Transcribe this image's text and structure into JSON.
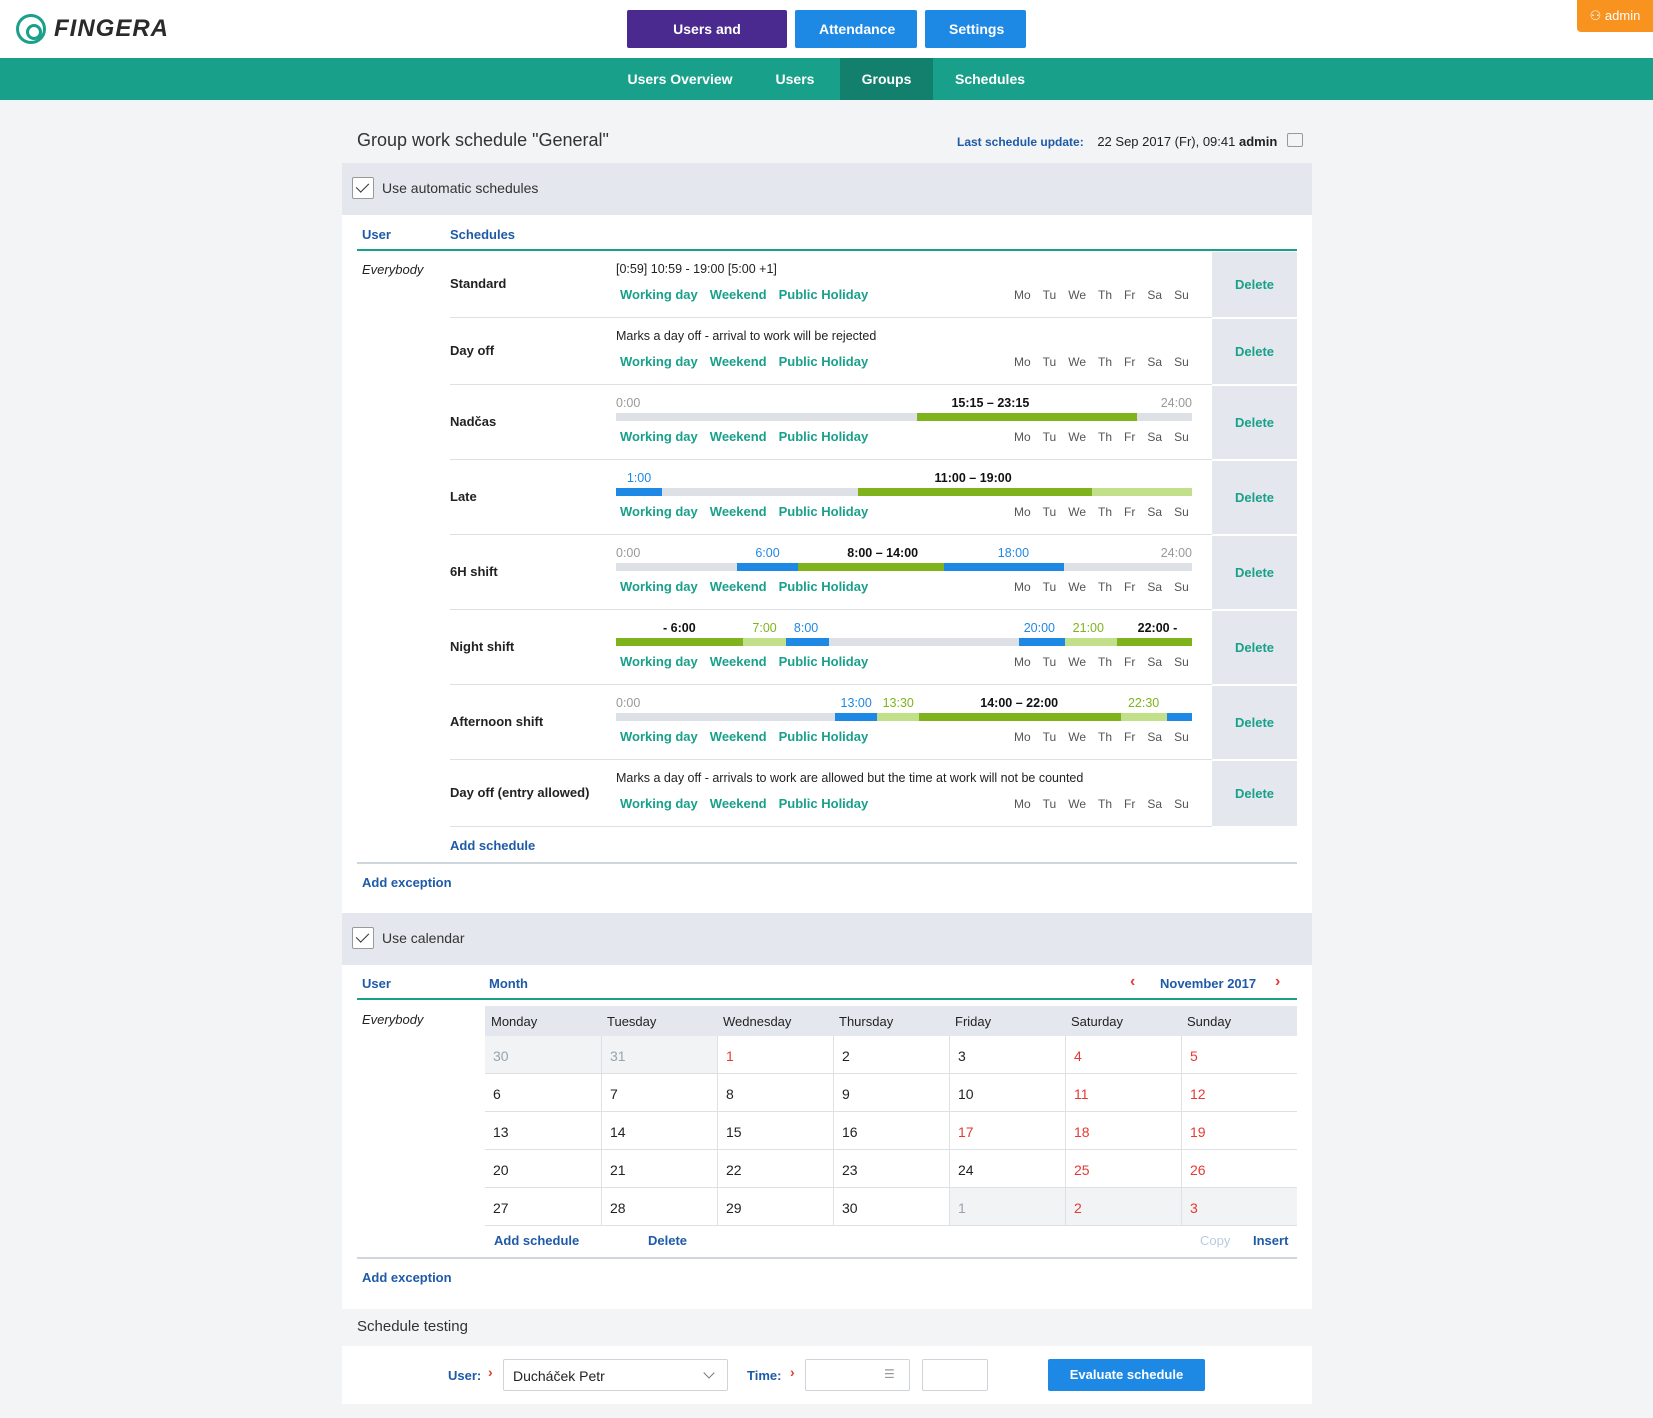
{
  "brand": {
    "name": "FINGERA"
  },
  "topnav": {
    "users_groups": "Users and groups",
    "attendance": "Attendance",
    "settings": "Settings"
  },
  "admin_badge": "admin",
  "subnav": {
    "overview": "Users Overview",
    "users": "Users",
    "groups": "Groups",
    "schedules": "Schedules"
  },
  "page": {
    "title": "Group work schedule \"General\"",
    "last_update_label": "Last schedule update:",
    "last_update_value": "22 Sep 2017 (Fr), 09:41",
    "last_update_user": "admin"
  },
  "auto": {
    "checkbox_label": "Use automatic schedules",
    "col_user": "User",
    "col_schedules": "Schedules",
    "user": "Everybody",
    "tags": [
      "Working day",
      "Weekend",
      "Public Holiday"
    ],
    "days": [
      "Mo",
      "Tu",
      "We",
      "Th",
      "Fr",
      "Sa",
      "Su"
    ],
    "delete": "Delete",
    "add_schedule": "Add schedule",
    "add_exception": "Add exception",
    "rows": [
      {
        "name": "Standard",
        "desc": "[0:59] 10:59 - 19:00 [5:00 +1]"
      },
      {
        "name": "Day off",
        "desc": "Marks a day off - arrival to work will be rejected"
      },
      {
        "name": "Nadčas",
        "labels": [
          "0:00",
          "15:15 – 23:15",
          "24:00"
        ]
      },
      {
        "name": "Late",
        "labels": [
          "1:00",
          "11:00 – 19:00"
        ]
      },
      {
        "name": "6H shift",
        "labels": [
          "0:00",
          "6:00",
          "8:00 – 14:00",
          "18:00",
          "24:00"
        ]
      },
      {
        "name": "Night shift",
        "labels": [
          "- 6:00",
          "7:00",
          "8:00",
          "20:00",
          "21:00",
          "22:00 -"
        ]
      },
      {
        "name": "Afternoon shift",
        "labels": [
          "0:00",
          "13:00",
          "13:30",
          "14:00 – 22:00",
          "22:30"
        ]
      },
      {
        "name": "Day off (entry allowed)",
        "desc": "Marks a day off - arrivals to work are allowed but the time at work will not be counted"
      }
    ]
  },
  "calendar": {
    "checkbox_label": "Use calendar",
    "col_user": "User",
    "col_month": "Month",
    "month": "November 2017",
    "user": "Everybody",
    "weekdays": [
      "Monday",
      "Tuesday",
      "Wednesday",
      "Thursday",
      "Friday",
      "Saturday",
      "Sunday"
    ],
    "weeks": [
      [
        "30",
        "31",
        "1",
        "2",
        "3",
        "4",
        "5"
      ],
      [
        "6",
        "7",
        "8",
        "9",
        "10",
        "11",
        "12"
      ],
      [
        "13",
        "14",
        "15",
        "16",
        "17",
        "18",
        "19"
      ],
      [
        "20",
        "21",
        "22",
        "23",
        "24",
        "25",
        "26"
      ],
      [
        "27",
        "28",
        "29",
        "30",
        "1",
        "2",
        "3"
      ]
    ],
    "add_schedule": "Add schedule",
    "delete": "Delete",
    "copy": "Copy",
    "insert": "Insert",
    "add_exception": "Add exception"
  },
  "testing": {
    "title": "Schedule testing",
    "user_label": "User:",
    "user_value": "Ducháček Petr",
    "time_label": "Time:",
    "button": "Evaluate schedule"
  }
}
